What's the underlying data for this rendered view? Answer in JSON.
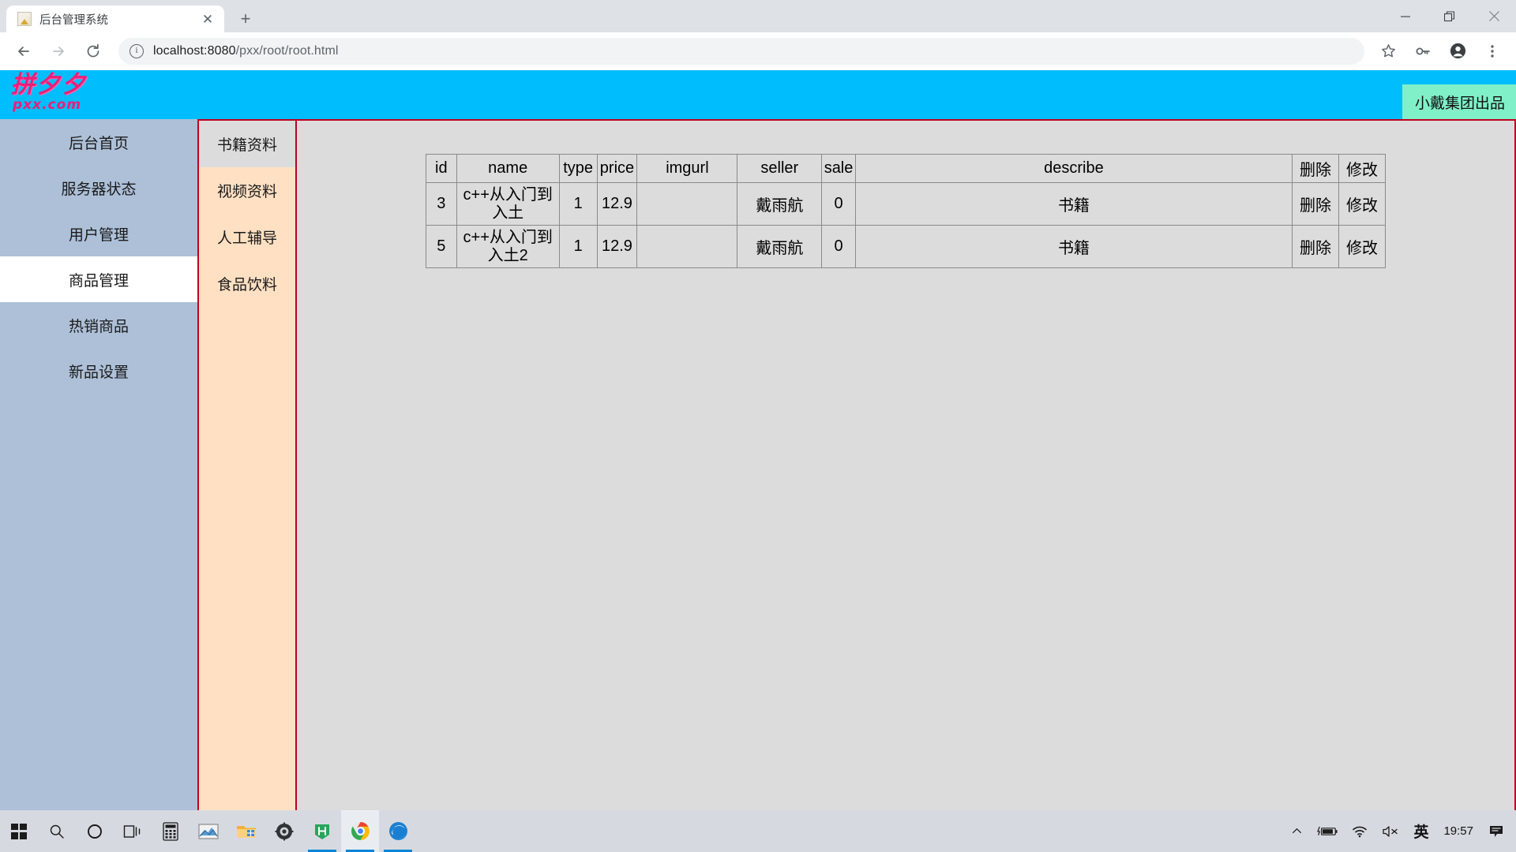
{
  "browser": {
    "tab": {
      "title": "后台管理系统",
      "favicon": "page-favicon",
      "close_label": "✕"
    },
    "new_tab_label": "+",
    "window_controls": {
      "minimize": "minimize-icon",
      "maximize": "maximize-icon",
      "close": "close-icon"
    },
    "nav": {
      "back": "back-arrow-icon",
      "forward": "forward-arrow-icon",
      "reload": "reload-icon"
    },
    "omnibox": {
      "info_icon": "site-info-icon",
      "host": "localhost:8080",
      "path": "/pxx/root/root.html"
    },
    "actions": {
      "bookmark": "star-icon",
      "passwords": "key-icon",
      "profile": "avatar-icon",
      "menu": "three-dot-menu-icon"
    }
  },
  "page": {
    "logo": {
      "cn": "拼夕夕",
      "en": "pxx.com"
    },
    "brand_tag": "小戴集团出品",
    "sidebar": {
      "items": [
        {
          "label": "后台首页",
          "active": false
        },
        {
          "label": "服务器状态",
          "active": false
        },
        {
          "label": "用户管理",
          "active": false
        },
        {
          "label": "商品管理",
          "active": true
        },
        {
          "label": "热销商品",
          "active": false
        },
        {
          "label": "新品设置",
          "active": false
        }
      ]
    },
    "submenu": {
      "items": [
        {
          "label": "书籍资料",
          "active": true
        },
        {
          "label": "视频资料",
          "active": false
        },
        {
          "label": "人工辅导",
          "active": false
        },
        {
          "label": "食品饮料",
          "active": false
        }
      ]
    },
    "table": {
      "headers": [
        "id",
        "name",
        "type",
        "price",
        "imgurl",
        "seller",
        "sale",
        "describe",
        "删除",
        "修改"
      ],
      "rows": [
        {
          "id": "3",
          "name": "c++从入门到入土",
          "type": "1",
          "price": "12.9",
          "imgurl": "",
          "seller": "戴雨航",
          "sale": "0",
          "describe": "书籍",
          "delete": "删除",
          "edit": "修改"
        },
        {
          "id": "5",
          "name": "c++从入门到入土2",
          "type": "1",
          "price": "12.9",
          "imgurl": "",
          "seller": "戴雨航",
          "sale": "0",
          "describe": "书籍",
          "delete": "删除",
          "edit": "修改"
        }
      ]
    }
  },
  "taskbar": {
    "items": [
      {
        "name": "start-button"
      },
      {
        "name": "search-icon"
      },
      {
        "name": "cortana-icon"
      },
      {
        "name": "task-view-icon"
      },
      {
        "name": "calculator-icon"
      },
      {
        "name": "photos-icon"
      },
      {
        "name": "file-explorer-icon"
      },
      {
        "name": "settings-icon"
      },
      {
        "name": "hbuilder-icon"
      },
      {
        "name": "chrome-icon"
      },
      {
        "name": "edge-icon"
      }
    ],
    "tray": {
      "overflow": "chevron-up-icon",
      "battery": "battery-charging-icon",
      "wifi": "wifi-icon",
      "volume": "volume-muted-icon",
      "ime": "英",
      "clock": "19:57",
      "notifications": "notification-icon"
    }
  },
  "colors": {
    "banner": "#00bdfe",
    "brand_tag_bg": "#7ff0c8",
    "sidebar_bg": "#adc0d8",
    "submenu_bg": "#ffe0c2",
    "content_border": "#c00020",
    "content_bg": "#dcdcdc",
    "logo_pink": "#ec1e79"
  }
}
